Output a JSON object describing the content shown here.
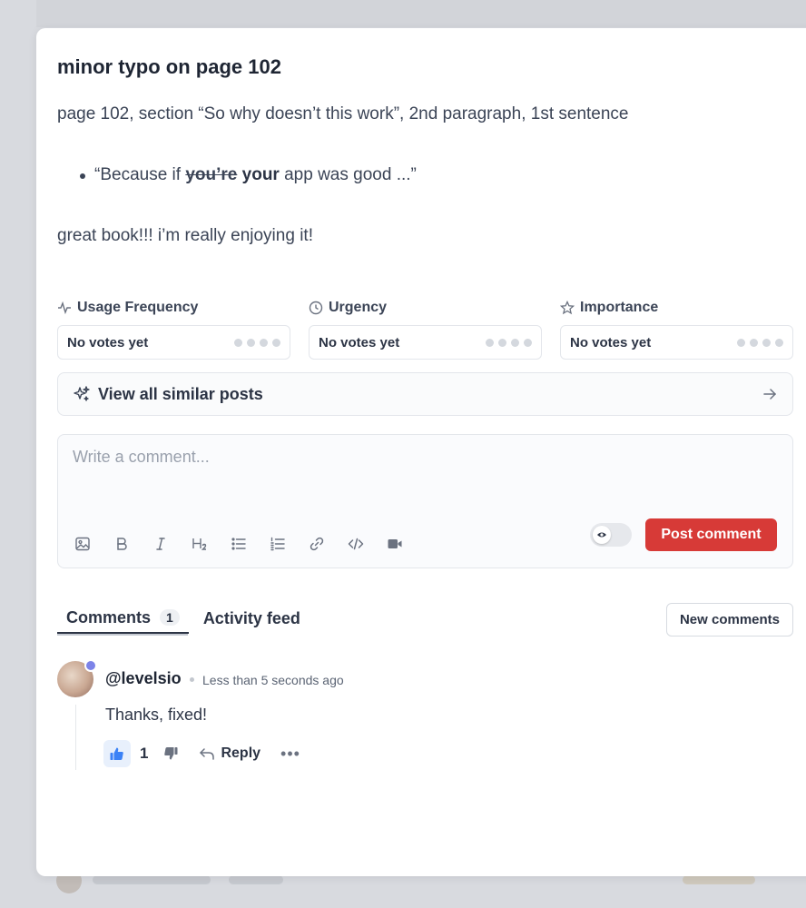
{
  "post": {
    "title": "minor typo on page 102",
    "paragraph1": "page 102, section “So why doesn’t this work”, 2nd paragraph, 1st sentence",
    "bullet_prefix": "“Because if ",
    "bullet_struck": "you’re",
    "bullet_correct": "your",
    "bullet_suffix": " app was good ...”",
    "paragraph2": "great book!!! i’m really enjoying it!"
  },
  "votes": [
    {
      "label": "Usage Frequency",
      "icon": "activity-icon",
      "value": "No votes yet"
    },
    {
      "label": "Urgency",
      "icon": "clock-icon",
      "value": "No votes yet"
    },
    {
      "label": "Importance",
      "icon": "star-icon",
      "value": "No votes yet"
    }
  ],
  "similar": {
    "label": "View all similar posts"
  },
  "composer": {
    "placeholder": "Write a comment...",
    "post_label": "Post comment"
  },
  "tabs": {
    "comments_label": "Comments",
    "comments_count": "1",
    "activity_label": "Activity feed",
    "new_comments_label": "New comments"
  },
  "comment": {
    "author": "@levelsio",
    "time": "Less than 5 seconds ago",
    "text": "Thanks, fixed!",
    "likes": "1",
    "reply_label": "Reply",
    "more_label": "•••"
  },
  "colors": {
    "accent_red": "#d73a37",
    "like_blue": "#3b82f6",
    "verified_purple": "#7c83e8"
  }
}
